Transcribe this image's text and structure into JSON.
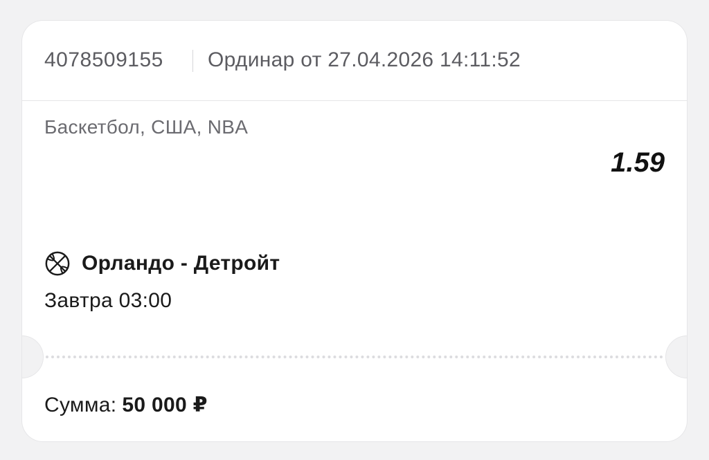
{
  "ticket": {
    "bet_id": "4078509155",
    "bet_type": "Ординар от 27.04.2026 14:11:52",
    "league": "Баскетбол, США, NBA",
    "odds": "1.59",
    "event": {
      "icon": "basketball-icon",
      "name": "Орландо - Детройт",
      "time": "Завтра 03:00"
    },
    "sum": {
      "label": "Сумма:",
      "value": "50 000 ₽"
    }
  }
}
